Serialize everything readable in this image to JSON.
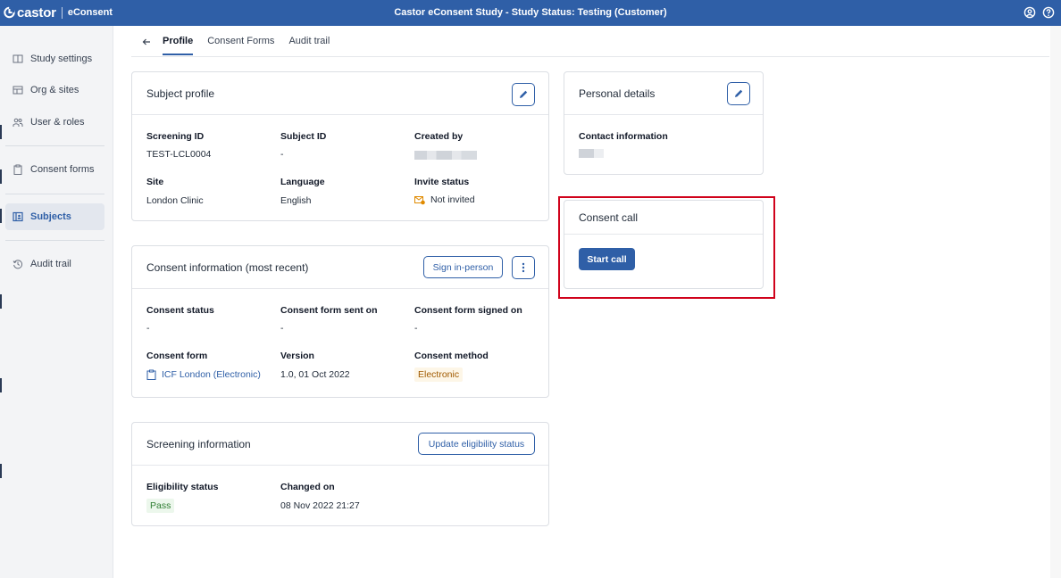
{
  "topbar": {
    "logo": "castor",
    "product": "eConsent",
    "title": "Castor eConsent Study  - Study Status: Testing (Customer)"
  },
  "sidebar": {
    "items": [
      {
        "label": "Study settings",
        "icon": "book-icon"
      },
      {
        "label": "Org & sites",
        "icon": "building-icon"
      },
      {
        "label": "User & roles",
        "icon": "users-icon"
      },
      {
        "label": "Consent forms",
        "icon": "clipboard-icon"
      },
      {
        "label": "Subjects",
        "icon": "subject-id-icon",
        "active": true
      },
      {
        "label": "Audit trail",
        "icon": "history-icon"
      }
    ]
  },
  "tabs": [
    {
      "label": "Profile",
      "active": true
    },
    {
      "label": "Consent Forms"
    },
    {
      "label": "Audit trail"
    }
  ],
  "subject_profile": {
    "title": "Subject profile",
    "screening_id_label": "Screening ID",
    "screening_id": "TEST-LCL0004",
    "subject_id_label": "Subject ID",
    "subject_id": "-",
    "created_by_label": "Created by",
    "site_label": "Site",
    "site": "London Clinic",
    "language_label": "Language",
    "language": "English",
    "invite_status_label": "Invite status",
    "invite_status": "Not invited"
  },
  "consent_info": {
    "title": "Consent information (most recent)",
    "sign_button": "Sign in-person",
    "status_label": "Consent status",
    "status": "-",
    "sent_label": "Consent form sent on",
    "sent": "-",
    "signed_label": "Consent form signed on",
    "signed": "-",
    "form_label": "Consent form",
    "form": "ICF London (Electronic)",
    "version_label": "Version",
    "version": "1.0, 01 Oct 2022",
    "method_label": "Consent method",
    "method": "Electronic"
  },
  "screening_info": {
    "title": "Screening information",
    "update_button": "Update eligibility status",
    "eligibility_label": "Eligibility status",
    "eligibility": "Pass",
    "changed_label": "Changed on",
    "changed": "08 Nov 2022 21:27"
  },
  "personal_details": {
    "title": "Personal details",
    "contact_label": "Contact information"
  },
  "consent_call": {
    "title": "Consent call",
    "button": "Start call"
  },
  "colors": {
    "brand": "#2f5fa7",
    "highlight": "#d0021b"
  }
}
